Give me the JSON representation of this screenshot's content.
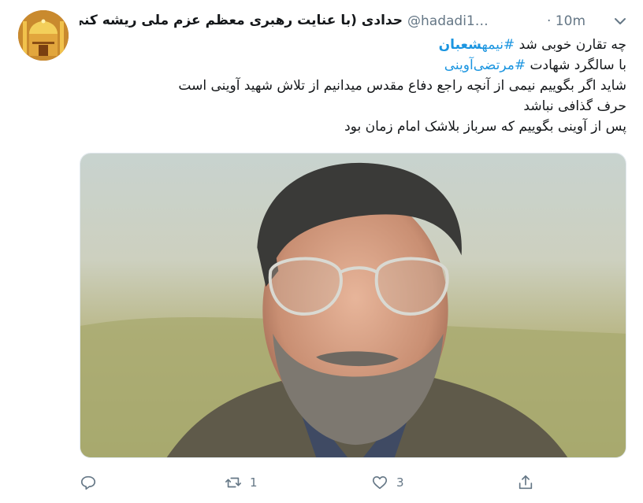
{
  "tweet": {
    "author": {
      "display_name": "حدادی (با عنایت رهبری معظم عزم ملی ریشه کنی کرونا)",
      "handle": "@hadadi1…",
      "avatar_icon": "shrine-dome-avatar"
    },
    "time": "· 10m",
    "text_lines": [
      {
        "prefix": "چه تقارن خوبی شد ",
        "hashtag": "#نیمه",
        "bold": "شعبان",
        "suffix": ""
      },
      {
        "prefix": "با سالگرد شهادت ",
        "hashtag": "#مرتضی‌آوینی",
        "bold": "",
        "suffix": ""
      },
      {
        "prefix": "شاید اگر بگوییم نیمی از آنچه راجع دفاع مقدس میدانیم از تلاش شهید آوینی است",
        "hashtag": "",
        "bold": "",
        "suffix": ""
      },
      {
        "prefix": "حرف گذافی نباشد",
        "hashtag": "",
        "bold": "",
        "suffix": ""
      },
      {
        "prefix": "پس از آوینی بگوییم که سرباز بلاشک امام زمان بود",
        "hashtag": "",
        "bold": "",
        "suffix": ""
      }
    ],
    "media": {
      "description_icon": "portrait-photo"
    },
    "actions": {
      "reply": {
        "icon": "reply-icon",
        "count": ""
      },
      "retweet": {
        "icon": "retweet-icon",
        "count": "1"
      },
      "like": {
        "icon": "heart-icon",
        "count": "3"
      },
      "share": {
        "icon": "share-icon",
        "count": ""
      }
    }
  },
  "colors": {
    "link": "#1b95e0",
    "muted": "#657786",
    "text": "#14171a"
  }
}
